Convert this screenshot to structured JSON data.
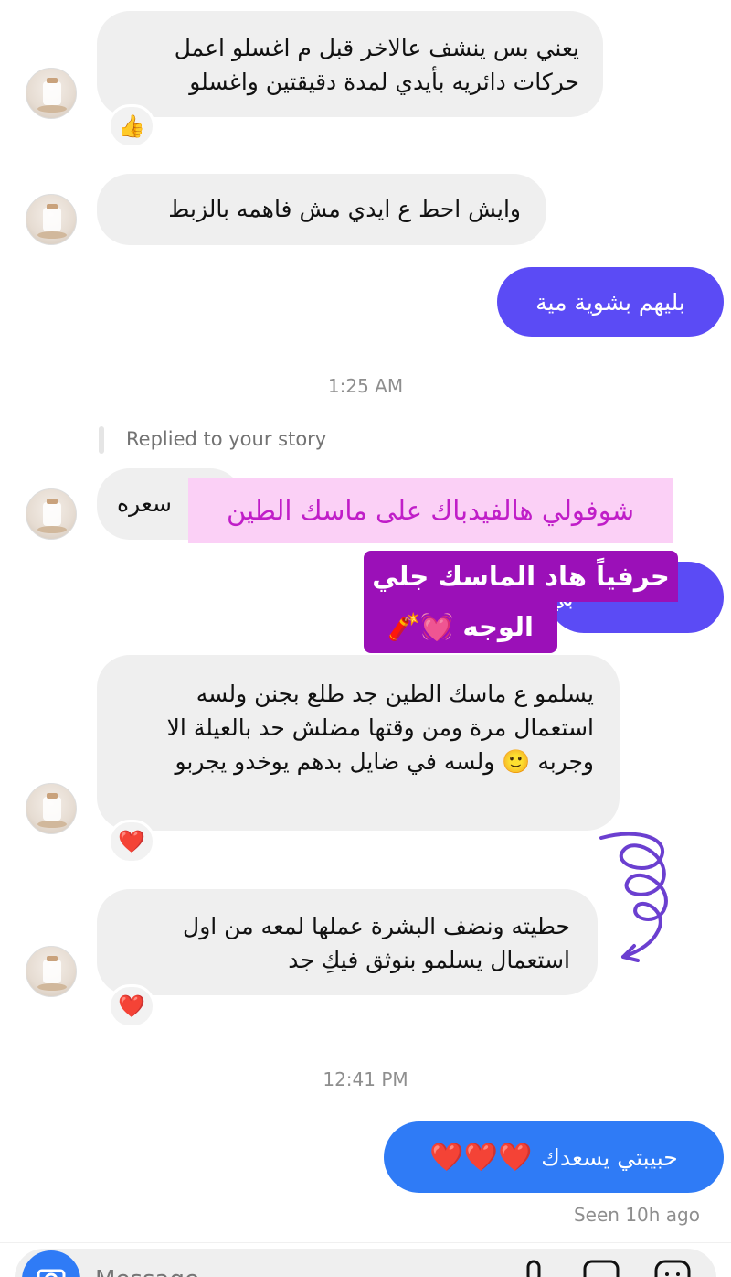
{
  "messages": {
    "m1": "يعني بس ينشف عالاخر قبل م اغسلو اعمل حركات دائريه بأيدي لمدة دقيقتين واغسلو",
    "m2": "وايش احط ع ايدي مش فاهمه بالزبط",
    "m3_out": "بليهم بشوية مية",
    "replied_label": "Replied to your story",
    "m4_partial": "سعره",
    "m5_out_partial": "بي",
    "m6": "يسلمو ع ماسك الطين جد طلع بجنن ولسه استعمال مرة ومن وقتها مضلش حد بالعيلة الا وجربه 🙂 ولسه في ضايل بدهم يوخدو يجربو",
    "m7": "حطيته ونضف البشرة عملها لمعه من اول استعمال يسلمو بنوثق فيكِ جد",
    "m8_out": "حبيبتي يسعدك",
    "m8_hearts": "❤️❤️❤️"
  },
  "timestamps": {
    "t1": "1:25 AM",
    "t2": "12:41 PM"
  },
  "status": {
    "seen": "Seen 10h ago"
  },
  "stickers": {
    "pink_text": "شوفولي هالفيدباك على ماسك الطين",
    "purple_line1": "حرفياً هاد الماسك جلي بجلي",
    "purple_line2": "الوجه 💓🧨"
  },
  "reactions": {
    "r1": "👍",
    "r2": "❤️",
    "r3": "❤️"
  },
  "input": {
    "placeholder": "Message..."
  },
  "icons": {
    "camera": "camera-icon",
    "mic": "mic-icon",
    "gallery": "gallery-icon",
    "sticker": "sticker-icon",
    "doodle": "purple-spiral-arrow-doodle"
  },
  "colors": {
    "incoming_bg": "#efefef",
    "outgoing_purple": "#5b4bf5",
    "outgoing_blue": "#2f7bf6",
    "sticker_pink_bg": "#fbd0f6",
    "sticker_pink_text": "#c01ec8",
    "sticker_purple_bg": "#9b10b8",
    "timestamp": "#8e8e8e"
  }
}
